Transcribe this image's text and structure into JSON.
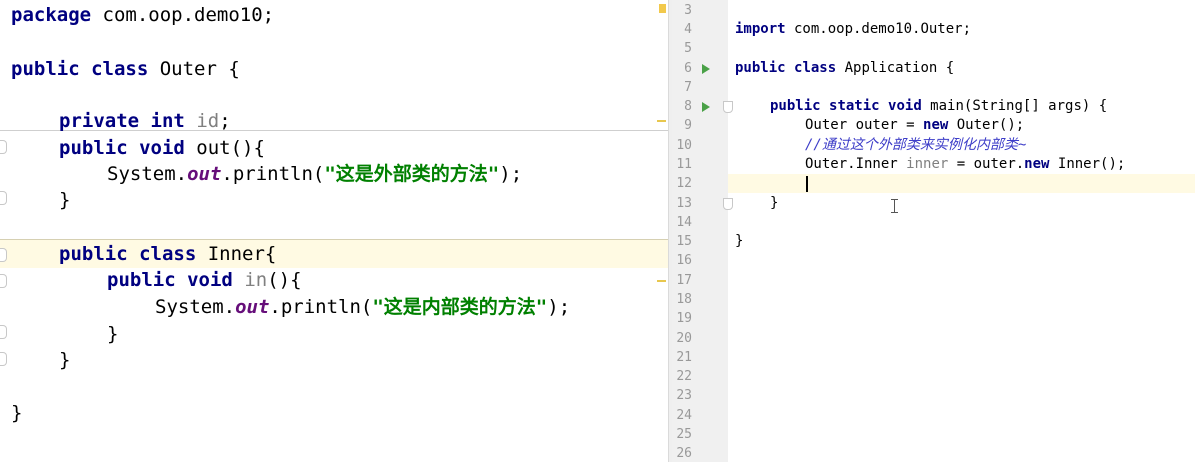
{
  "left_editor": {
    "lines": {
      "l1": {
        "kw": "package",
        "rest": " com.oop.demo10;"
      },
      "l2": {
        "kw1": "public",
        "kw2": "class",
        "rest": " Outer {"
      },
      "l3": {
        "kw1": "private",
        "kw2": "int",
        "field": "id",
        "rest": ";"
      },
      "l4": {
        "kw1": "public",
        "kw2": "void",
        "rest": " out(){"
      },
      "l5": {
        "pre": "System.",
        "fld": "out",
        "mid": ".println(",
        "str": "\"这是外部类的方法\"",
        "post": ");"
      },
      "l6": {
        "text": "}"
      },
      "l7": {
        "kw1": "public",
        "kw2": "class",
        "rest": " Inner{"
      },
      "l8": {
        "kw1": "public",
        "kw2": "void",
        "name": "in",
        "rest": "(){"
      },
      "l9": {
        "pre": "System.",
        "fld": "out",
        "mid": ".println(",
        "str": "\"这是内部类的方法\"",
        "post": ");"
      },
      "l10": {
        "text": "}"
      },
      "l11": {
        "text": "}"
      },
      "l12": {
        "text": "}"
      }
    }
  },
  "right_editor": {
    "line_numbers": [
      "3",
      "4",
      "5",
      "6",
      "7",
      "8",
      "9",
      "10",
      "11",
      "12",
      "13",
      "14",
      "15",
      "16",
      "17",
      "18",
      "19",
      "20",
      "21",
      "22",
      "23",
      "24",
      "25",
      "26"
    ],
    "lines": {
      "r4": {
        "kw": "import",
        "rest": " com.oop.demo10.Outer;"
      },
      "r6": {
        "kw1": "public",
        "kw2": "class",
        "rest": " Application {"
      },
      "r8": {
        "kw1": "public",
        "kw2": "static",
        "kw3": "void",
        "rest": " main(String[] args) {"
      },
      "r9": {
        "pre": "Outer outer = ",
        "kw": "new",
        "post": " Outer();"
      },
      "r10": {
        "comment": "//通过这个外部类来实例化内部类~"
      },
      "r11": {
        "pre": "Outer.Inner ",
        "unused": "inner",
        "mid": " = outer.",
        "kw": "new",
        "post": " Inner();"
      },
      "r13": {
        "text": "}"
      },
      "r15": {
        "text": "}"
      }
    }
  }
}
